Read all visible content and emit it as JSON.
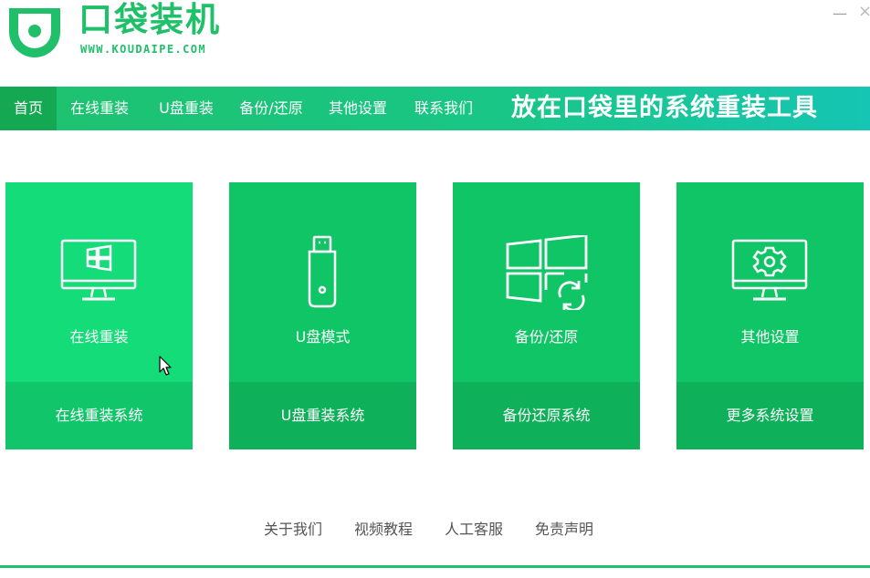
{
  "app": {
    "title": "口袋装机",
    "subtitle": "WWW.KOUDAIPE.COM",
    "slogan": "放在口袋里的系统重装工具",
    "accent_color": "#20c06a"
  },
  "window_controls": {
    "minimize": "—",
    "close": "×"
  },
  "nav": {
    "items": [
      {
        "label": "首页",
        "active": true
      },
      {
        "label": "在线重装",
        "active": false
      },
      {
        "label": "U盘重装",
        "active": false
      },
      {
        "label": "备份/还原",
        "active": false
      },
      {
        "label": "其他设置",
        "active": false
      },
      {
        "label": "联系我们",
        "active": false
      }
    ]
  },
  "cards": [
    {
      "title": "在线重装",
      "action": "在线重装系统",
      "icon": "monitor-windows-icon"
    },
    {
      "title": "U盘模式",
      "action": "U盘重装系统",
      "icon": "usb-drive-icon"
    },
    {
      "title": "备份/还原",
      "action": "备份还原系统",
      "icon": "windows-restore-icon"
    },
    {
      "title": "其他设置",
      "action": "更多系统设置",
      "icon": "monitor-gear-icon"
    }
  ],
  "footer": {
    "links": [
      "关于我们",
      "视频教程",
      "人工客服",
      "免责声明"
    ]
  }
}
